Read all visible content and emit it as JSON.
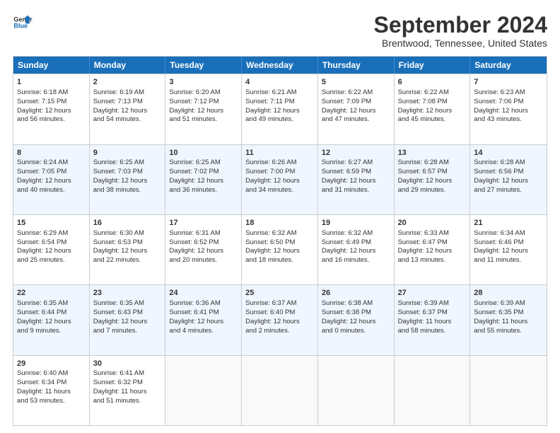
{
  "logo": {
    "line1": "General",
    "line2": "Blue"
  },
  "title": "September 2024",
  "location": "Brentwood, Tennessee, United States",
  "headers": [
    "Sunday",
    "Monday",
    "Tuesday",
    "Wednesday",
    "Thursday",
    "Friday",
    "Saturday"
  ],
  "rows": [
    [
      {
        "day": "",
        "empty": true
      },
      {
        "day": "",
        "empty": true
      },
      {
        "day": "",
        "empty": true
      },
      {
        "day": "",
        "empty": true
      },
      {
        "day": "",
        "empty": true
      },
      {
        "day": "",
        "empty": true
      },
      {
        "day": "",
        "empty": true
      }
    ],
    [
      {
        "day": "1",
        "rise": "6:18 AM",
        "set": "7:15 PM",
        "daylight": "12 hours and 56 minutes."
      },
      {
        "day": "2",
        "rise": "6:19 AM",
        "set": "7:13 PM",
        "daylight": "12 hours and 54 minutes."
      },
      {
        "day": "3",
        "rise": "6:20 AM",
        "set": "7:12 PM",
        "daylight": "12 hours and 51 minutes."
      },
      {
        "day": "4",
        "rise": "6:21 AM",
        "set": "7:11 PM",
        "daylight": "12 hours and 49 minutes."
      },
      {
        "day": "5",
        "rise": "6:22 AM",
        "set": "7:09 PM",
        "daylight": "12 hours and 47 minutes."
      },
      {
        "day": "6",
        "rise": "6:22 AM",
        "set": "7:08 PM",
        "daylight": "12 hours and 45 minutes."
      },
      {
        "day": "7",
        "rise": "6:23 AM",
        "set": "7:06 PM",
        "daylight": "12 hours and 43 minutes."
      }
    ],
    [
      {
        "day": "8",
        "rise": "6:24 AM",
        "set": "7:05 PM",
        "daylight": "12 hours and 40 minutes."
      },
      {
        "day": "9",
        "rise": "6:25 AM",
        "set": "7:03 PM",
        "daylight": "12 hours and 38 minutes."
      },
      {
        "day": "10",
        "rise": "6:25 AM",
        "set": "7:02 PM",
        "daylight": "12 hours and 36 minutes."
      },
      {
        "day": "11",
        "rise": "6:26 AM",
        "set": "7:00 PM",
        "daylight": "12 hours and 34 minutes."
      },
      {
        "day": "12",
        "rise": "6:27 AM",
        "set": "6:59 PM",
        "daylight": "12 hours and 31 minutes."
      },
      {
        "day": "13",
        "rise": "6:28 AM",
        "set": "6:57 PM",
        "daylight": "12 hours and 29 minutes."
      },
      {
        "day": "14",
        "rise": "6:28 AM",
        "set": "6:56 PM",
        "daylight": "12 hours and 27 minutes."
      }
    ],
    [
      {
        "day": "15",
        "rise": "6:29 AM",
        "set": "6:54 PM",
        "daylight": "12 hours and 25 minutes."
      },
      {
        "day": "16",
        "rise": "6:30 AM",
        "set": "6:53 PM",
        "daylight": "12 hours and 22 minutes."
      },
      {
        "day": "17",
        "rise": "6:31 AM",
        "set": "6:52 PM",
        "daylight": "12 hours and 20 minutes."
      },
      {
        "day": "18",
        "rise": "6:32 AM",
        "set": "6:50 PM",
        "daylight": "12 hours and 18 minutes."
      },
      {
        "day": "19",
        "rise": "6:32 AM",
        "set": "6:49 PM",
        "daylight": "12 hours and 16 minutes."
      },
      {
        "day": "20",
        "rise": "6:33 AM",
        "set": "6:47 PM",
        "daylight": "12 hours and 13 minutes."
      },
      {
        "day": "21",
        "rise": "6:34 AM",
        "set": "6:46 PM",
        "daylight": "12 hours and 11 minutes."
      }
    ],
    [
      {
        "day": "22",
        "rise": "6:35 AM",
        "set": "6:44 PM",
        "daylight": "12 hours and 9 minutes."
      },
      {
        "day": "23",
        "rise": "6:35 AM",
        "set": "6:43 PM",
        "daylight": "12 hours and 7 minutes."
      },
      {
        "day": "24",
        "rise": "6:36 AM",
        "set": "6:41 PM",
        "daylight": "12 hours and 4 minutes."
      },
      {
        "day": "25",
        "rise": "6:37 AM",
        "set": "6:40 PM",
        "daylight": "12 hours and 2 minutes."
      },
      {
        "day": "26",
        "rise": "6:38 AM",
        "set": "6:38 PM",
        "daylight": "12 hours and 0 minutes."
      },
      {
        "day": "27",
        "rise": "6:39 AM",
        "set": "6:37 PM",
        "daylight": "11 hours and 58 minutes."
      },
      {
        "day": "28",
        "rise": "6:39 AM",
        "set": "6:35 PM",
        "daylight": "11 hours and 55 minutes."
      }
    ],
    [
      {
        "day": "29",
        "rise": "6:40 AM",
        "set": "6:34 PM",
        "daylight": "11 hours and 53 minutes."
      },
      {
        "day": "30",
        "rise": "6:41 AM",
        "set": "6:32 PM",
        "daylight": "11 hours and 51 minutes."
      },
      {
        "day": "",
        "empty": true
      },
      {
        "day": "",
        "empty": true
      },
      {
        "day": "",
        "empty": true
      },
      {
        "day": "",
        "empty": true
      },
      {
        "day": "",
        "empty": true
      }
    ]
  ]
}
